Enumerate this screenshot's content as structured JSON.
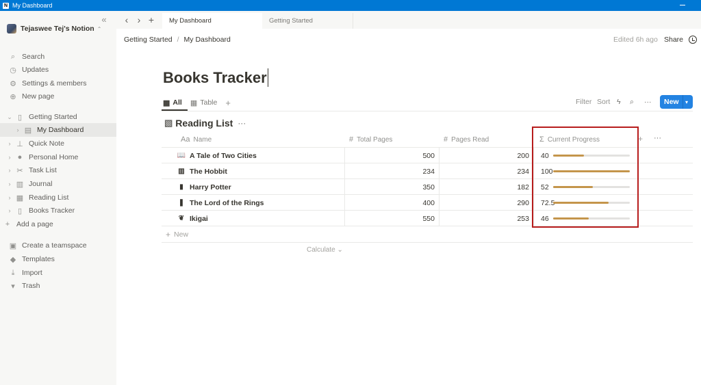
{
  "window": {
    "title": "My Dashboard"
  },
  "sidebar": {
    "workspace": "Tejaswee Tej's Notion",
    "top_items": [
      {
        "label": "Search",
        "icon": "search-icon"
      },
      {
        "label": "Updates",
        "icon": "clock-icon"
      },
      {
        "label": "Settings & members",
        "icon": "gear-icon"
      },
      {
        "label": "New page",
        "icon": "plus-circle-icon"
      }
    ],
    "pages": [
      {
        "label": "Getting Started",
        "icon": "page-icon",
        "level": 0
      },
      {
        "label": "My Dashboard",
        "icon": "dashboard-icon",
        "level": 1,
        "active": true
      },
      {
        "label": "Quick Note",
        "icon": "pin-icon",
        "level": 0
      },
      {
        "label": "Personal Home",
        "icon": "person-icon",
        "level": 0
      },
      {
        "label": "Task List",
        "icon": "scissors-icon",
        "level": 0
      },
      {
        "label": "Journal",
        "icon": "book-icon",
        "level": 0
      },
      {
        "label": "Reading List",
        "icon": "database-icon",
        "level": 0
      },
      {
        "label": "Books Tracker",
        "icon": "page-icon",
        "level": 0
      }
    ],
    "add_page": "Add a page",
    "bottom_items": [
      {
        "label": "Create a teamspace",
        "icon": "teamspace-icon"
      },
      {
        "label": "Templates",
        "icon": "templates-icon"
      },
      {
        "label": "Import",
        "icon": "import-icon"
      },
      {
        "label": "Trash",
        "icon": "trash-icon"
      }
    ]
  },
  "tabs": [
    {
      "label": "My Dashboard",
      "active": true
    },
    {
      "label": "Getting Started",
      "active": false
    }
  ],
  "topbar": {
    "breadcrumb": [
      "Getting Started",
      "My Dashboard"
    ],
    "edited": "Edited 6h ago",
    "share": "Share"
  },
  "page": {
    "title": "Books Tracker",
    "views": [
      {
        "label": "All",
        "active": true
      },
      {
        "label": "Table",
        "active": false
      }
    ],
    "toolbar": {
      "filter": "Filter",
      "sort": "Sort",
      "new": "New"
    },
    "database": {
      "title": "Reading List",
      "columns": {
        "name": "Name",
        "total": "Total Pages",
        "read": "Pages Read",
        "progress": "Current Progress"
      },
      "column_prefixes": {
        "name": "Aa",
        "total": "#",
        "read": "#",
        "progress": "Σ"
      },
      "rows": [
        {
          "icon": "open-book-icon",
          "name": "A Tale of Two Cities",
          "total": "500",
          "read": "200",
          "progress_label": "40",
          "progress": 40
        },
        {
          "icon": "book-icon",
          "name": "The Hobbit",
          "total": "234",
          "read": "234",
          "progress_label": "100",
          "progress": 100
        },
        {
          "icon": "notebook-icon",
          "name": "Harry Potter",
          "total": "350",
          "read": "182",
          "progress_label": "52",
          "progress": 52
        },
        {
          "icon": "bookmark-icon",
          "name": "The Lord of the Rings",
          "total": "400",
          "read": "290",
          "progress_label": "72.5",
          "progress": 72.5
        },
        {
          "icon": "plant-icon",
          "name": "Ikigai",
          "total": "550",
          "read": "253",
          "progress_label": "46",
          "progress": 46
        }
      ],
      "new_row": "New",
      "calculate": "Calculate"
    }
  },
  "colors": {
    "accent": "#2383e2",
    "progress": "#c4954b",
    "highlight": "#b71c1c",
    "titlebar": "#0078d4"
  }
}
